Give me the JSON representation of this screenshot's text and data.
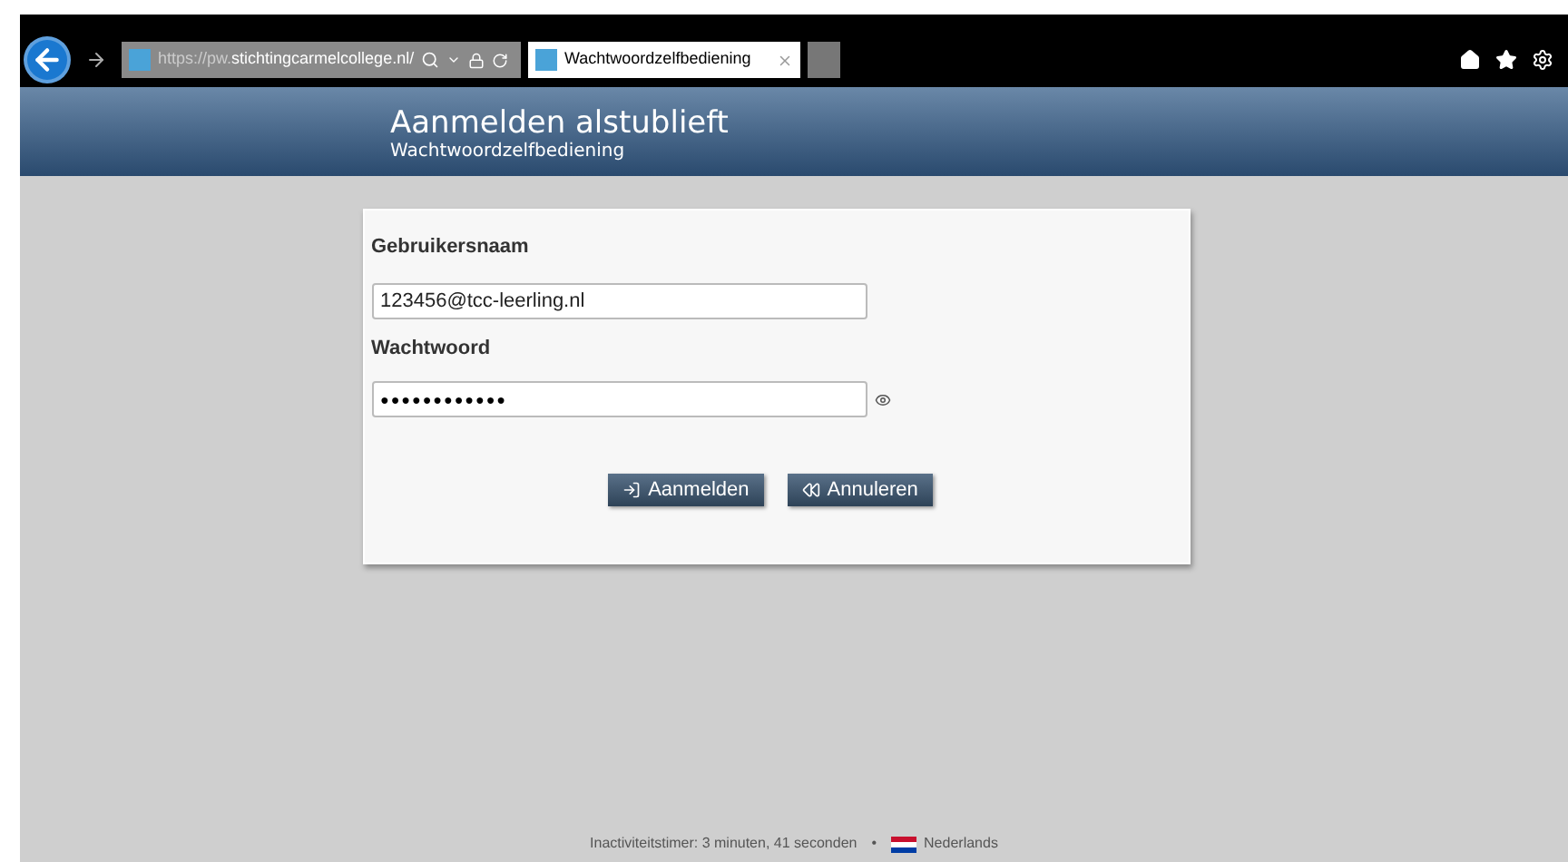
{
  "browser": {
    "url_prefix": "https://pw.",
    "url_domain": "stichtingcarmelcollege.nl/",
    "tab_title": "Wachtwoordzelfbediening"
  },
  "header": {
    "title": "Aanmelden alstublieft",
    "subtitle": "Wachtwoordzelfbediening"
  },
  "form": {
    "username_label": "Gebruikersnaam",
    "username_value": "123456@tcc-leerling.nl",
    "password_label": "Wachtwoord",
    "password_value": "●●●●●●●●●●●●"
  },
  "buttons": [
    {
      "kind": "login",
      "label": "Aanmelden"
    },
    {
      "kind": "cancel",
      "label": "Annuleren"
    }
  ],
  "footer": {
    "timer": "Inactiviteitstimer: 3 minuten, 41 seconden",
    "separator": "•",
    "language": "Nederlands"
  }
}
